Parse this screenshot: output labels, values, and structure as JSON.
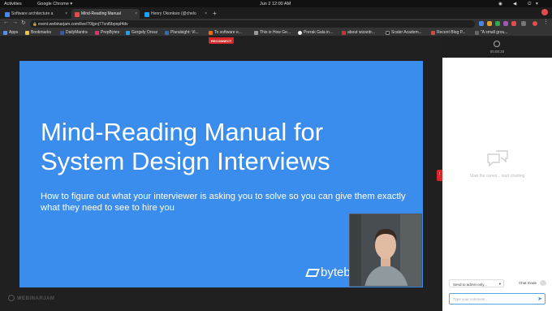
{
  "system_bar": {
    "activities": "Activities",
    "app": "Google Chrome",
    "app_caret": "▾",
    "datetime": "Jun 2  12:00 AM"
  },
  "tabs": [
    {
      "title": "Software architecture a",
      "close": "×",
      "favicon_color": "#4a86e8"
    },
    {
      "title": "Mind-Reading Manual",
      "close": "×",
      "favicon_color": "#e34c4c"
    },
    {
      "title": "Henry Okonkwo (@chelo",
      "close": "×",
      "favicon_color": "#1da1f2"
    }
  ],
  "new_tab": "+",
  "address_bar": {
    "url": "event.webinarjam.com/live/70/jpnj77cnt5bpnpf4dv"
  },
  "bookmarks": [
    {
      "label": "Apps",
      "color": "#5f8de0"
    },
    {
      "label": "Bookmarks",
      "color": "#f0c040"
    },
    {
      "label": "DailyMantra",
      "color": "#3b5998"
    },
    {
      "label": "PrepBytes",
      "color": "#e1306c"
    },
    {
      "label": "Gergely Orosz",
      "color": "#1da1f2"
    },
    {
      "label": "Pluralsight: Vi...",
      "color": "#2e6db4"
    },
    {
      "label": "To software e...",
      "color": "#ff6600"
    },
    {
      "label": "This is How Ge...",
      "color": "#999999"
    },
    {
      "label": "Prerak Gala in...",
      "color": "#eeeeee"
    },
    {
      "label": "about wizardr...",
      "color": "#cc3333"
    },
    {
      "label": "Scaler Academ...",
      "color": "#222222"
    },
    {
      "label": "Recent Blog P...",
      "color": "#d44"
    },
    {
      "label": "\"A small grou...",
      "color": "#666666"
    }
  ],
  "stage": {
    "reconnect": "RECONNECT",
    "slide_title": "Mind-Reading Manual for System Design Interviews",
    "slide_subtitle": "How to figure out what your interviewer is asking you to solve so you can give them exactly what they need to see to hire you",
    "logo_text": "byteb",
    "brand_footer": "WEBINARJAM"
  },
  "sidebar": {
    "timer": "00:00:20",
    "red_tab": "!",
    "empty_chat": "Start the convo... start chatting",
    "send_to": "Send to admin only...",
    "send_to_caret": "▾",
    "chat_mode_label": "Chat mode",
    "message_placeholder": "Type your comment...",
    "send_icon": "➤"
  },
  "colors": {
    "slide_bg": "#3a8ded",
    "reconnect_bg": "#d62828"
  }
}
